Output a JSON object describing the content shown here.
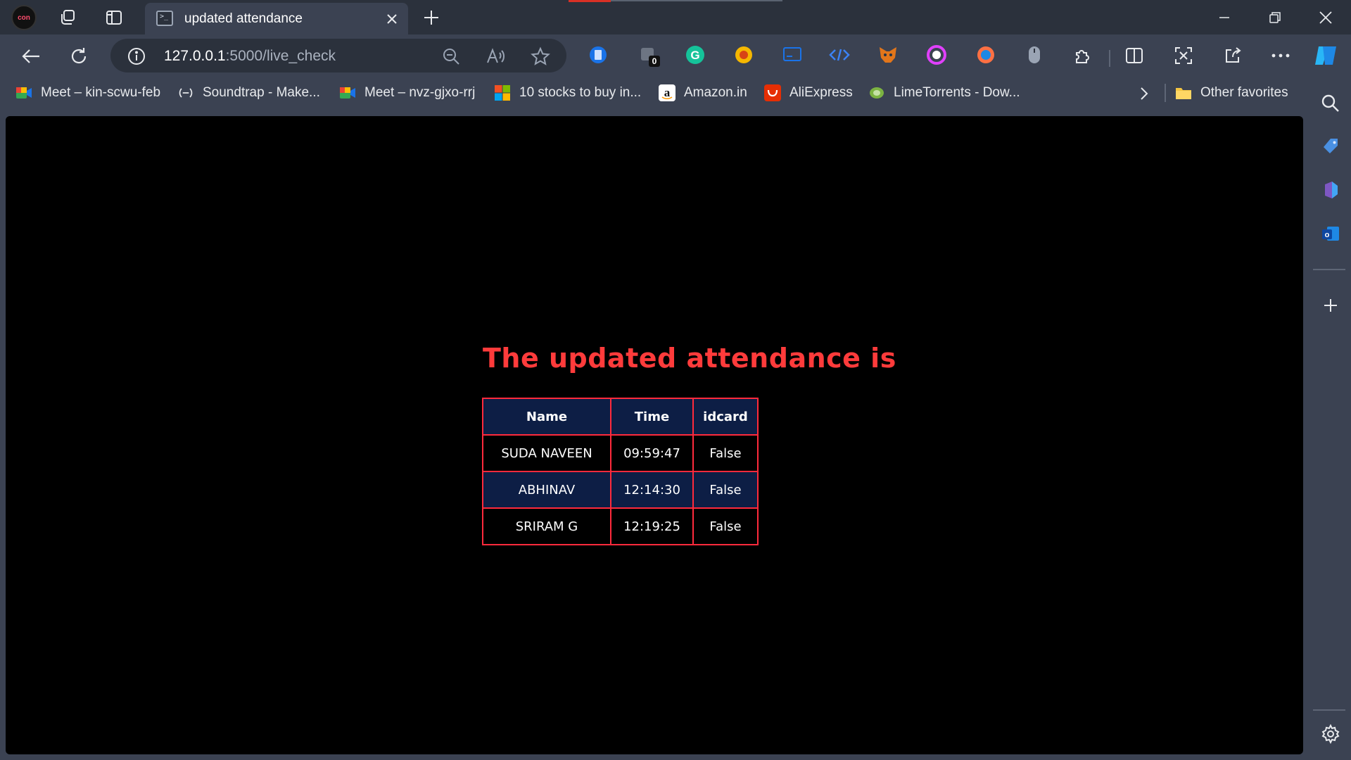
{
  "window": {
    "tab_title": "updated attendance",
    "profile_label": "con",
    "icons": {
      "workspaces": "workspaces-icon",
      "vertical_tabs": "vertical-tabs-icon",
      "close_tab": "close-icon",
      "new_tab": "plus-icon",
      "minimize": "minimize-icon",
      "restore": "restore-icon",
      "close_window": "close-icon"
    }
  },
  "toolbar": {
    "url_host": "127.0.0.1",
    "url_path": ":5000/live_check",
    "extension_badge": "0",
    "icons": [
      "back-icon",
      "refresh-icon",
      "info-icon",
      "zoom-out-icon",
      "read-aloud-icon",
      "favorite-star-icon",
      "extensions-icon",
      "split-screen-icon",
      "screenshot-icon",
      "share-icon",
      "more-icon",
      "copilot-icon"
    ]
  },
  "favorites": {
    "items": [
      {
        "label": "Meet – kin-scwu-feb",
        "icon": "google-meet-icon"
      },
      {
        "label": "Soundtrap - Make...",
        "icon": "soundtrap-icon"
      },
      {
        "label": "Meet – nvz-gjxo-rrj",
        "icon": "google-meet-icon"
      },
      {
        "label": "10 stocks to buy in...",
        "icon": "microsoft-icon"
      },
      {
        "label": "Amazon.in",
        "icon": "amazon-icon"
      },
      {
        "label": "AliExpress",
        "icon": "aliexpress-icon"
      },
      {
        "label": "LimeTorrents - Dow...",
        "icon": "limetorrents-icon"
      }
    ],
    "other": "Other favorites"
  },
  "page": {
    "heading": "The updated attendance is",
    "table": {
      "headers": [
        "Name",
        "Time",
        "idcard"
      ],
      "rows": [
        [
          "SUDA NAVEEN",
          "09:59:47",
          "False"
        ],
        [
          "ABHINAV",
          "12:14:30",
          "False"
        ],
        [
          "SRIRAM G",
          "12:19:25",
          "False"
        ]
      ]
    }
  },
  "colors": {
    "heading": "#ff3b3b",
    "table_border": "#ff2a3c",
    "row_dark": "#0d1e45",
    "page_bg": "#000000",
    "chrome_bg": "#3b4252"
  }
}
